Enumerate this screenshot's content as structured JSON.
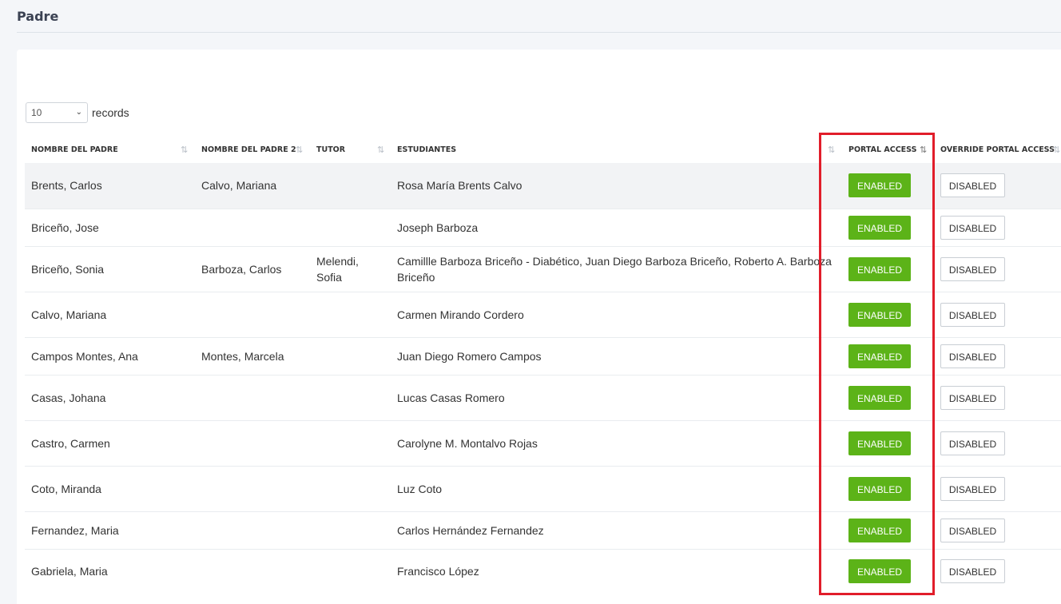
{
  "page": {
    "title": "Padre"
  },
  "length_menu": {
    "value": "10",
    "label": "records"
  },
  "table": {
    "columns": [
      "NOMBRE DEL PADRE",
      "NOMBRE DEL PADRE 2",
      "TUTOR",
      "ESTUDIANTES",
      "PORTAL ACCESS",
      "OVERRIDE PORTAL ACCESS"
    ],
    "rows": [
      {
        "padre": "Brents, Carlos",
        "padre2": "Calvo, Mariana",
        "tutor": "",
        "estudiantes": "Rosa María Brents Calvo",
        "portal": "ENABLED",
        "override": "DISABLED"
      },
      {
        "padre": "Briceño, Jose",
        "padre2": "",
        "tutor": "",
        "estudiantes": "Joseph Barboza",
        "portal": "ENABLED",
        "override": "DISABLED"
      },
      {
        "padre": "Briceño, Sonia",
        "padre2": "Barboza, Carlos",
        "tutor": "Melendi, Sofia",
        "estudiantes": "Camillle Barboza Briceño - Diabético, Juan Diego Barboza Briceño, Roberto A. Barboza Briceño",
        "portal": "ENABLED",
        "override": "DISABLED"
      },
      {
        "padre": "Calvo, Mariana",
        "padre2": "",
        "tutor": "",
        "estudiantes": "Carmen Mirando Cordero",
        "portal": "ENABLED",
        "override": "DISABLED"
      },
      {
        "padre": "Campos Montes, Ana",
        "padre2": "Montes, Marcela",
        "tutor": "",
        "estudiantes": "Juan Diego Romero Campos",
        "portal": "ENABLED",
        "override": "DISABLED"
      },
      {
        "padre": "Casas, Johana",
        "padre2": "",
        "tutor": "",
        "estudiantes": "Lucas Casas Romero",
        "portal": "ENABLED",
        "override": "DISABLED"
      },
      {
        "padre": "Castro, Carmen",
        "padre2": "",
        "tutor": "",
        "estudiantes": "Carolyne M. Montalvo Rojas",
        "portal": "ENABLED",
        "override": "DISABLED"
      },
      {
        "padre": "Coto, Miranda",
        "padre2": "",
        "tutor": "",
        "estudiantes": "Luz Coto",
        "portal": "ENABLED",
        "override": "DISABLED"
      },
      {
        "padre": "Fernandez, Maria",
        "padre2": "",
        "tutor": "",
        "estudiantes": "Carlos Hernández Fernandez",
        "portal": "ENABLED",
        "override": "DISABLED"
      },
      {
        "padre": "Gabriela, Maria",
        "padre2": "",
        "tutor": "",
        "estudiantes": "Francisco López",
        "portal": "ENABLED",
        "override": "DISABLED"
      }
    ]
  },
  "icons": {
    "sort": "sort-icon",
    "sort_active": "sort-amount-icon",
    "select_arrow": "chevron-down-icon"
  },
  "colors": {
    "enabled_bg": "#5cb318",
    "highlight": "#e11d2a",
    "shaded_row": "#f2f3f5"
  }
}
